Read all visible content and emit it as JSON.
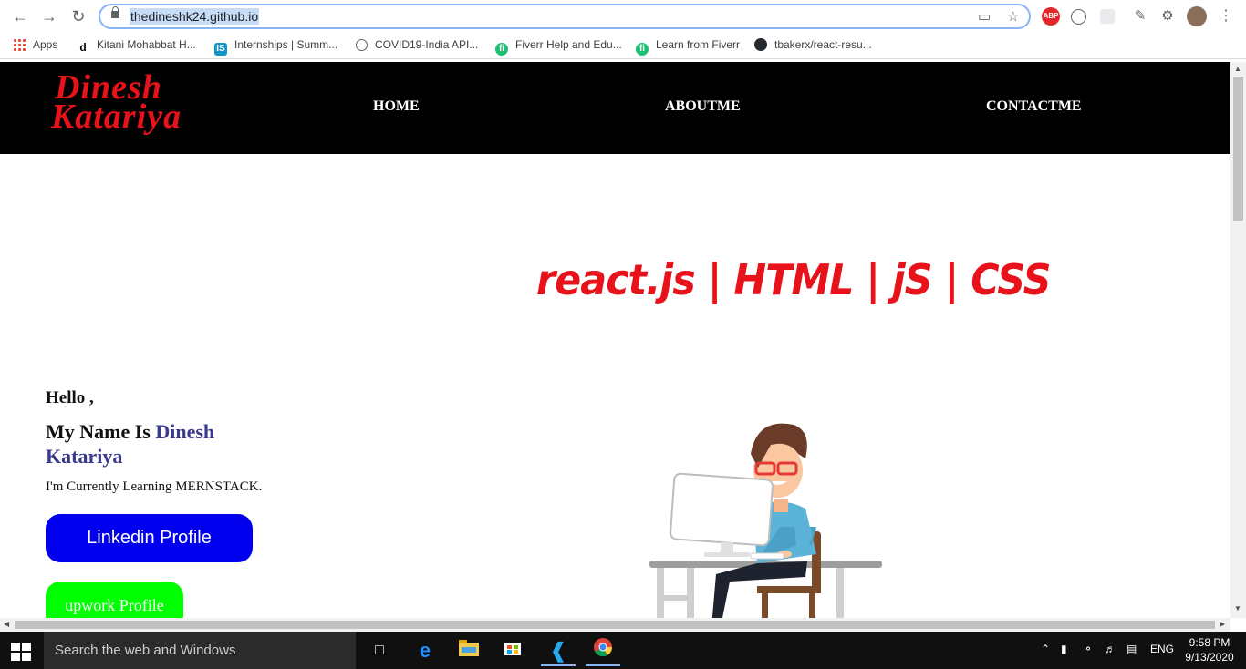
{
  "browser": {
    "url": "thedineshk24.github.io",
    "bookmarks": [
      {
        "label": "Apps",
        "icon": "apps-grid-icon"
      },
      {
        "label": "Kitani Mohabbat H...",
        "icon": "d-icon"
      },
      {
        "label": "Internships | Summ...",
        "icon": "internshala-icon"
      },
      {
        "label": "COVID19-India API...",
        "icon": "globe-icon"
      },
      {
        "label": "Fiverr Help and Edu...",
        "icon": "fiverr-icon"
      },
      {
        "label": "Learn from Fiverr",
        "icon": "fiverr-icon"
      },
      {
        "label": "tbakerx/react-resu...",
        "icon": "github-icon"
      }
    ],
    "extensions": {
      "abp": "ABP"
    }
  },
  "site": {
    "logo": {
      "line1": "Dinesh",
      "line2": "Katariya"
    },
    "nav": [
      "HOME",
      "ABOUTME",
      "CONTACTME"
    ],
    "skills": "react.js | HTML | jS | CSS",
    "intro": {
      "hello": "Hello ,",
      "name_prefix": "My Name Is ",
      "name": "Dinesh Katariya",
      "learning": "I'm Currently Learning MERNSTACK."
    },
    "buttons": {
      "linkedin": "Linkedin Profile",
      "upwork": "upwork Profile"
    },
    "colors": {
      "brand": "#e8121b",
      "linkedin": "#0000ee",
      "upwork": "#00ff00",
      "name": "#3a3a8c"
    }
  },
  "taskbar": {
    "search_placeholder": "Search the web and Windows",
    "language": "ENG",
    "time": "9:58 PM",
    "date": "9/13/2020"
  }
}
